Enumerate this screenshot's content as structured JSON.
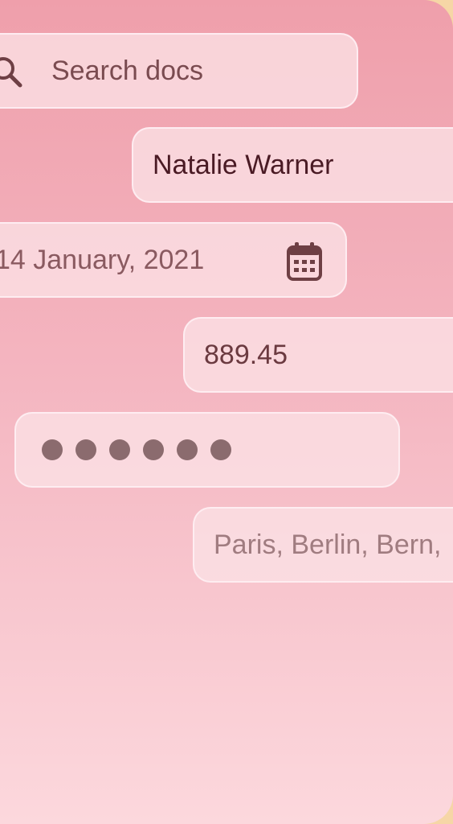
{
  "search": {
    "placeholder": "Search docs",
    "icon": "search-icon"
  },
  "name_field": {
    "value": "Natalie Warner"
  },
  "date_field": {
    "value": "14 January, 2021",
    "icon": "calendar-icon"
  },
  "number_field": {
    "value": "889.45"
  },
  "password_field": {
    "masked_length": 6
  },
  "tags_field": {
    "placeholder": "Paris, Berlin, Bern,"
  },
  "colors": {
    "icon": "#6e3f44",
    "dot": "#8b6b6e"
  }
}
